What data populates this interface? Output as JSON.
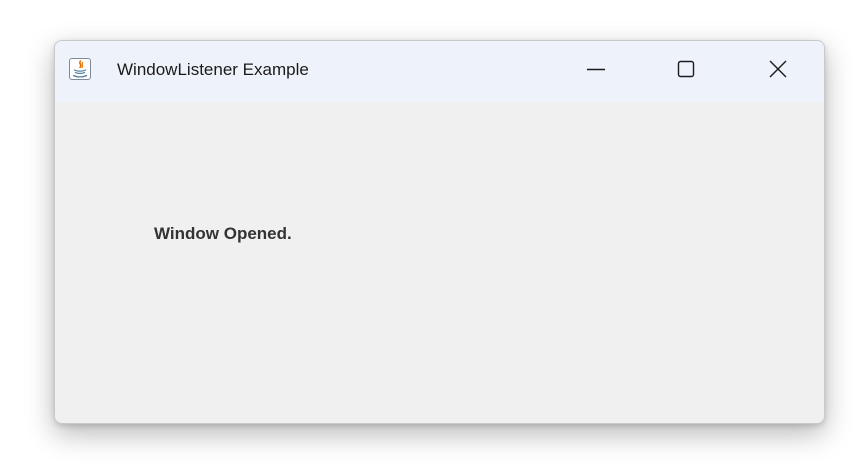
{
  "window": {
    "title": "WindowListener Example",
    "app_icon": "java-icon",
    "controls": {
      "minimize_icon": "minimize-icon",
      "maximize_icon": "maximize-icon",
      "close_icon": "close-icon"
    }
  },
  "content": {
    "status_text": "Window Opened."
  },
  "colors": {
    "titlebar": "#eef3fb",
    "window_bg": "#f0f0f0",
    "text": "#333333"
  }
}
